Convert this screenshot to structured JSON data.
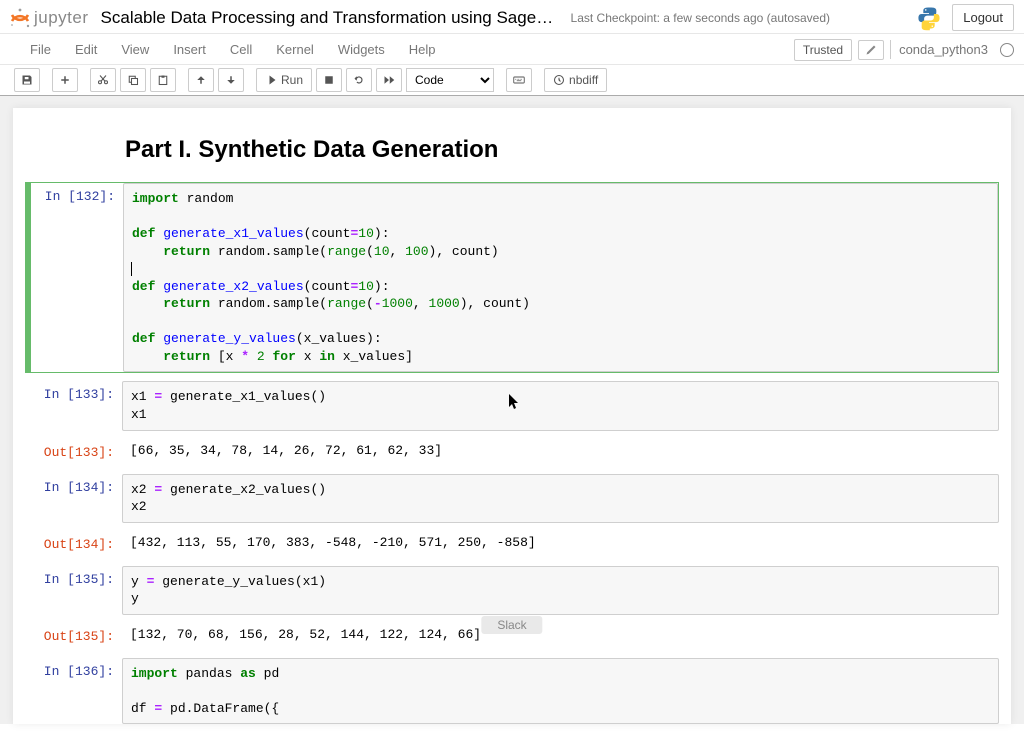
{
  "header": {
    "logo_text": "jupyter",
    "title": "Scalable Data Processing and Transformation using SageMaker Pr…",
    "checkpoint": "Last Checkpoint: a few seconds ago  (autosaved)",
    "logout": "Logout"
  },
  "menubar": {
    "items": [
      "File",
      "Edit",
      "View",
      "Insert",
      "Cell",
      "Kernel",
      "Widgets",
      "Help"
    ],
    "trusted": "Trusted",
    "kernel": "conda_python3"
  },
  "toolbar": {
    "run": "Run",
    "cell_type": "Code",
    "nbdiff": "nbdiff"
  },
  "heading": "Part I. Synthetic Data Generation",
  "cells": [
    {
      "prompt": "In [132]:",
      "code_tokens": [
        [
          {
            "t": "import",
            "c": "kw"
          },
          {
            "t": " random"
          }
        ],
        [],
        [
          {
            "t": "def",
            "c": "kw"
          },
          {
            "t": " "
          },
          {
            "t": "generate_x1_values",
            "c": "fn"
          },
          {
            "t": "(count"
          },
          {
            "t": "=",
            "c": "op"
          },
          {
            "t": "10",
            "c": "num"
          },
          {
            "t": "):"
          }
        ],
        [
          {
            "t": "    "
          },
          {
            "t": "return",
            "c": "kw"
          },
          {
            "t": " random.sample("
          },
          {
            "t": "range",
            "c": "bi"
          },
          {
            "t": "("
          },
          {
            "t": "10",
            "c": "num"
          },
          {
            "t": ", "
          },
          {
            "t": "100",
            "c": "num"
          },
          {
            "t": "), count)"
          }
        ],
        [
          {
            "t": "",
            "cursor": true
          }
        ],
        [
          {
            "t": "def",
            "c": "kw"
          },
          {
            "t": " "
          },
          {
            "t": "generate_x2_values",
            "c": "fn"
          },
          {
            "t": "(count"
          },
          {
            "t": "=",
            "c": "op"
          },
          {
            "t": "10",
            "c": "num"
          },
          {
            "t": "):"
          }
        ],
        [
          {
            "t": "    "
          },
          {
            "t": "return",
            "c": "kw"
          },
          {
            "t": " random.sample("
          },
          {
            "t": "range",
            "c": "bi"
          },
          {
            "t": "("
          },
          {
            "t": "-",
            "c": "op"
          },
          {
            "t": "1000",
            "c": "num"
          },
          {
            "t": ", "
          },
          {
            "t": "1000",
            "c": "num"
          },
          {
            "t": "), count)"
          }
        ],
        [],
        [
          {
            "t": "def",
            "c": "kw"
          },
          {
            "t": " "
          },
          {
            "t": "generate_y_values",
            "c": "fn"
          },
          {
            "t": "(x_values):"
          }
        ],
        [
          {
            "t": "    "
          },
          {
            "t": "return",
            "c": "kw"
          },
          {
            "t": " [x "
          },
          {
            "t": "*",
            "c": "op"
          },
          {
            "t": " "
          },
          {
            "t": "2",
            "c": "num"
          },
          {
            "t": " "
          },
          {
            "t": "for",
            "c": "kw"
          },
          {
            "t": " x "
          },
          {
            "t": "in",
            "c": "kw"
          },
          {
            "t": " x_values]"
          }
        ]
      ],
      "selected": true
    },
    {
      "prompt": "In [133]:",
      "code_tokens": [
        [
          {
            "t": "x1 "
          },
          {
            "t": "=",
            "c": "op"
          },
          {
            "t": " generate_x1_values()"
          }
        ],
        [
          {
            "t": "x1"
          }
        ]
      ],
      "out_prompt": "Out[133]:",
      "output": "[66, 35, 34, 78, 14, 26, 72, 61, 62, 33]"
    },
    {
      "prompt": "In [134]:",
      "code_tokens": [
        [
          {
            "t": "x2 "
          },
          {
            "t": "=",
            "c": "op"
          },
          {
            "t": " generate_x2_values()"
          }
        ],
        [
          {
            "t": "x2"
          }
        ]
      ],
      "out_prompt": "Out[134]:",
      "output": "[432, 113, 55, 170, 383, -548, -210, 571, 250, -858]"
    },
    {
      "prompt": "In [135]:",
      "code_tokens": [
        [
          {
            "t": "y "
          },
          {
            "t": "=",
            "c": "op"
          },
          {
            "t": " generate_y_values(x1)"
          }
        ],
        [
          {
            "t": "y"
          }
        ]
      ],
      "out_prompt": "Out[135]:",
      "output": "[132, 70, 68, 156, 28, 52, 144, 122, 124, 66]"
    },
    {
      "prompt": "In [136]:",
      "code_tokens": [
        [
          {
            "t": "import",
            "c": "kw"
          },
          {
            "t": " pandas "
          },
          {
            "t": "as",
            "c": "kw"
          },
          {
            "t": " pd"
          }
        ],
        [],
        [
          {
            "t": "df "
          },
          {
            "t": "=",
            "c": "op"
          },
          {
            "t": " pd.DataFrame({"
          }
        ]
      ]
    }
  ],
  "slack": "Slack"
}
